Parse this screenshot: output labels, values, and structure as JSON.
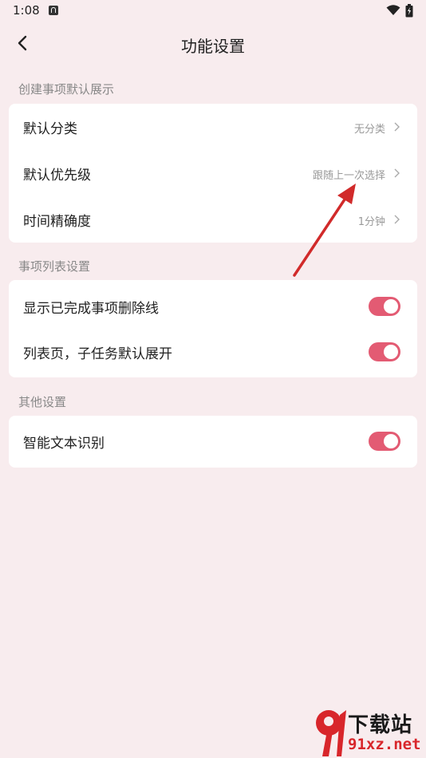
{
  "status_bar": {
    "time": "1:08"
  },
  "header": {
    "title": "功能设置"
  },
  "sections": [
    {
      "title": "创建事项默认展示",
      "items": [
        {
          "label": "默认分类",
          "value": "无分类"
        },
        {
          "label": "默认优先级",
          "value": "跟随上一次选择"
        },
        {
          "label": "时间精确度",
          "value": "1分钟"
        }
      ]
    },
    {
      "title": "事项列表设置",
      "items": [
        {
          "label": "显示已完成事项删除线",
          "toggle": true
        },
        {
          "label": "列表页，子任务默认展开",
          "toggle": true
        }
      ]
    },
    {
      "title": "其他设置",
      "items": [
        {
          "label": "智能文本识别",
          "toggle": true
        }
      ]
    }
  ],
  "colors": {
    "background": "#f8ecee",
    "toggle_on": "#e35b73",
    "annotation_arrow": "#d12a2a"
  },
  "watermark": {
    "title": "下载站",
    "url": "91xz.net"
  }
}
